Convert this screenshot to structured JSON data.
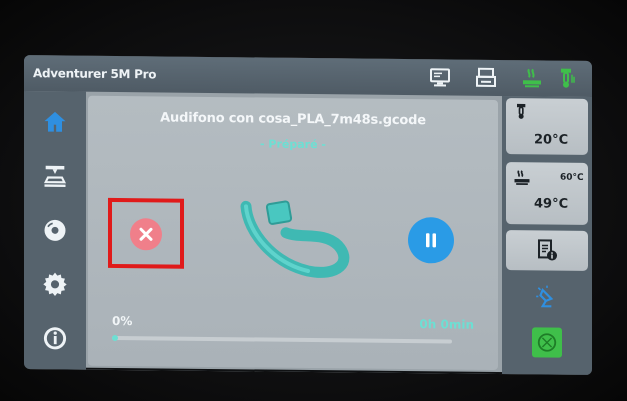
{
  "header": {
    "app_title": "Adventurer 5M Pro",
    "icons": [
      "monitor-icon",
      "printer-icon",
      "bed-heating-icon",
      "nozzle-heating-icon"
    ]
  },
  "sidebar": {
    "items": [
      {
        "name": "home",
        "icon": "home-icon",
        "active": true
      },
      {
        "name": "print",
        "icon": "print-bed-icon"
      },
      {
        "name": "files",
        "icon": "disc-icon"
      },
      {
        "name": "settings",
        "icon": "gear-icon"
      },
      {
        "name": "info",
        "icon": "info-icon"
      }
    ]
  },
  "job": {
    "filename": "Audifono con cosa_PLA_7m48s.gcode",
    "state": "- Préparé -",
    "progress_text": "0%",
    "progress_fraction": 0.0,
    "time_remaining": "0h 0min"
  },
  "temps": {
    "nozzle_current": "20°C",
    "bed_current": "49°C",
    "bed_target": "60°C"
  },
  "colors": {
    "accent_teal": "#6ddfd3",
    "pause_blue": "#2a9be6",
    "cancel_pink": "#f07f8a",
    "highlight_red": "#e01a1a",
    "active_green": "#3fbf4a"
  }
}
